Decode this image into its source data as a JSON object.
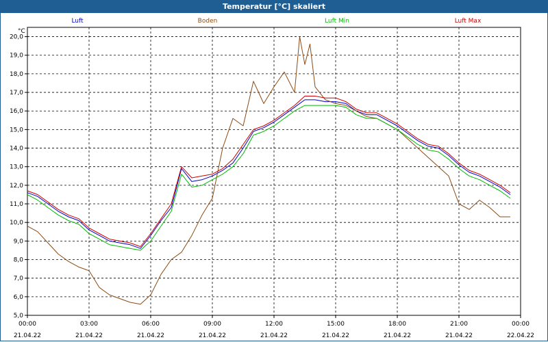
{
  "window": {
    "title": "Temperatur [°C] skaliert"
  },
  "chart_data": {
    "type": "line",
    "title": "Temperatur [°C] skaliert",
    "ylabel": "°C",
    "ylim": [
      5.0,
      20.5
    ],
    "yticks": [
      "5,0",
      "6,0",
      "7,0",
      "8,0",
      "9,0",
      "10,0",
      "11,0",
      "12,0",
      "13,0",
      "14,0",
      "15,0",
      "16,0",
      "17,0",
      "18,0",
      "19,0",
      "20,0"
    ],
    "xlim": [
      0,
      24
    ],
    "xticks": [
      {
        "time": "00:00",
        "date": "21.04.22"
      },
      {
        "time": "03:00",
        "date": "21.04.22"
      },
      {
        "time": "06:00",
        "date": "21.04.22"
      },
      {
        "time": "09:00",
        "date": "21.04.22"
      },
      {
        "time": "12:00",
        "date": "21.04.22"
      },
      {
        "time": "15:00",
        "date": "21.04.22"
      },
      {
        "time": "18:00",
        "date": "21.04.22"
      },
      {
        "time": "21:00",
        "date": "21.04.22"
      },
      {
        "time": "00:00",
        "date": "22.04.22"
      }
    ],
    "grid": true,
    "legend_position": "top",
    "series": [
      {
        "name": "Luft",
        "color": "#0000cc",
        "x": [
          0,
          0.5,
          1,
          1.5,
          2,
          2.5,
          3,
          3.5,
          4,
          4.5,
          5,
          5.5,
          6,
          6.5,
          7,
          7.5,
          8,
          8.5,
          9,
          9.5,
          10,
          10.5,
          11,
          11.5,
          12,
          12.5,
          13,
          13.5,
          14,
          14.5,
          15,
          15.5,
          16,
          16.5,
          17,
          17.5,
          18,
          18.5,
          19,
          19.5,
          20,
          20.5,
          21,
          21.5,
          22,
          22.5,
          23,
          23.5
        ],
        "y": [
          11.6,
          11.4,
          11.0,
          10.6,
          10.3,
          10.1,
          9.6,
          9.3,
          9.0,
          8.9,
          8.8,
          8.6,
          9.3,
          10.1,
          10.8,
          12.9,
          12.2,
          12.3,
          12.5,
          12.8,
          13.2,
          14.0,
          14.9,
          15.1,
          15.4,
          15.8,
          16.2,
          16.6,
          16.6,
          16.5,
          16.5,
          16.4,
          16.0,
          15.8,
          15.8,
          15.5,
          15.2,
          14.8,
          14.4,
          14.1,
          14.0,
          13.6,
          13.1,
          12.7,
          12.5,
          12.2,
          11.9,
          11.5
        ]
      },
      {
        "name": "Boden",
        "color": "#8b4a12",
        "x": [
          0,
          0.5,
          1,
          1.5,
          2,
          2.5,
          3,
          3.5,
          4,
          4.5,
          5,
          5.5,
          6,
          6.5,
          7,
          7.5,
          8,
          8.5,
          9,
          9.5,
          10,
          10.5,
          11,
          11.5,
          12,
          12.5,
          13,
          13.25,
          13.5,
          13.75,
          14,
          14.5,
          15,
          15.5,
          16,
          16.5,
          17,
          17.5,
          18,
          18.5,
          19,
          19.5,
          20,
          20.5,
          21,
          21.5,
          22,
          22.5,
          23,
          23.5
        ],
        "y": [
          9.8,
          9.5,
          8.9,
          8.3,
          7.9,
          7.6,
          7.4,
          6.5,
          6.1,
          5.9,
          5.7,
          5.6,
          6.1,
          7.2,
          8.0,
          8.4,
          9.3,
          10.4,
          11.3,
          14.0,
          15.6,
          15.2,
          17.6,
          16.4,
          17.3,
          18.1,
          17.0,
          20.0,
          18.5,
          19.6,
          17.3,
          16.6,
          16.4,
          16.3,
          16.0,
          15.7,
          15.6,
          15.3,
          15.0,
          14.5,
          14.0,
          13.5,
          13.0,
          12.5,
          11.0,
          10.7,
          11.2,
          10.8,
          10.3,
          10.3
        ]
      },
      {
        "name": "Luft Min",
        "color": "#00bb00",
        "x": [
          0,
          0.5,
          1,
          1.5,
          2,
          2.5,
          3,
          3.5,
          4,
          4.5,
          5,
          5.5,
          6,
          6.5,
          7,
          7.5,
          8,
          8.5,
          9,
          9.5,
          10,
          10.5,
          11,
          11.5,
          12,
          12.5,
          13,
          13.5,
          14,
          14.5,
          15,
          15.5,
          16,
          16.5,
          17,
          17.5,
          18,
          18.5,
          19,
          19.5,
          20,
          20.5,
          21,
          21.5,
          22,
          22.5,
          23,
          23.5
        ],
        "y": [
          11.5,
          11.2,
          10.8,
          10.4,
          10.1,
          9.9,
          9.4,
          9.1,
          8.8,
          8.7,
          8.6,
          8.5,
          9.0,
          9.8,
          10.6,
          12.6,
          11.9,
          12.0,
          12.3,
          12.6,
          13.0,
          13.7,
          14.7,
          14.9,
          15.2,
          15.6,
          16.0,
          16.3,
          16.3,
          16.3,
          16.3,
          16.2,
          15.8,
          15.6,
          15.6,
          15.3,
          15.0,
          14.6,
          14.2,
          13.9,
          13.8,
          13.4,
          12.9,
          12.5,
          12.3,
          12.0,
          11.7,
          11.3
        ]
      },
      {
        "name": "Luft Max",
        "color": "#cc0000",
        "x": [
          0,
          0.5,
          1,
          1.5,
          2,
          2.5,
          3,
          3.5,
          4,
          4.5,
          5,
          5.5,
          6,
          6.5,
          7,
          7.5,
          8,
          8.5,
          9,
          9.5,
          10,
          10.5,
          11,
          11.5,
          12,
          12.5,
          13,
          13.5,
          14,
          14.5,
          15,
          15.5,
          16,
          16.5,
          17,
          17.5,
          18,
          18.5,
          19,
          19.5,
          20,
          20.5,
          21,
          21.5,
          22,
          22.5,
          23,
          23.5
        ],
        "y": [
          11.7,
          11.5,
          11.1,
          10.7,
          10.4,
          10.2,
          9.7,
          9.4,
          9.1,
          9.0,
          8.9,
          8.7,
          9.4,
          10.2,
          11.0,
          13.0,
          12.4,
          12.5,
          12.6,
          12.9,
          13.4,
          14.2,
          15.0,
          15.2,
          15.5,
          15.9,
          16.3,
          16.8,
          16.8,
          16.7,
          16.7,
          16.5,
          16.1,
          15.9,
          15.9,
          15.6,
          15.3,
          14.9,
          14.5,
          14.2,
          14.1,
          13.7,
          13.2,
          12.8,
          12.6,
          12.3,
          12.0,
          11.6
        ]
      }
    ]
  }
}
